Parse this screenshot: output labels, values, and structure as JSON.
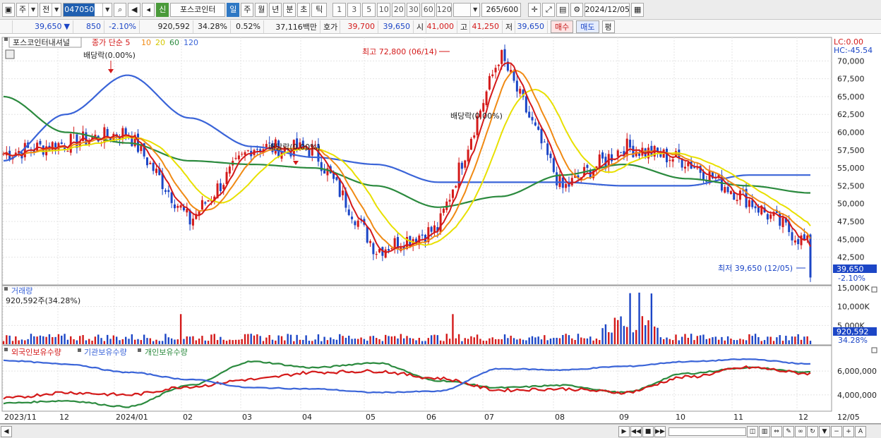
{
  "toolbar": {
    "period_main": "주",
    "prefix": "전",
    "stock_code": "047050",
    "stock_name": "포스코인터",
    "badge": "신",
    "periods": [
      "일",
      "주",
      "월",
      "년",
      "분",
      "초",
      "틱"
    ],
    "active_period": "일",
    "intervals": [
      "1",
      "3",
      "5",
      "10",
      "20",
      "30",
      "60",
      "120"
    ],
    "count": "265",
    "count_max": "/600",
    "date": "2024/12/05"
  },
  "quote": {
    "price": "39,650",
    "change_arrow": "▼",
    "change": "850",
    "change_pct": "-2.10%",
    "volume": "920,592",
    "volume_ratio": "34.28%",
    "turnover": "0.52%",
    "amount": "37,116백만",
    "ask_label": "호가",
    "ask": "39,700",
    "bid": "39,650",
    "open_label": "시",
    "open": "41,000",
    "high_label": "고",
    "high": "41,250",
    "low_label": "저",
    "low": "39,650",
    "buy_label": "매수",
    "sell_label": "매도",
    "eval_label": "평"
  },
  "price_pane": {
    "name_tag": "포스코인터내셔널",
    "legend": [
      {
        "label": "종가 단순 5",
        "color": "#d41a1a"
      },
      {
        "label": "10",
        "color": "#f08a14"
      },
      {
        "label": "20",
        "color": "#e8e000"
      },
      {
        "label": "60",
        "color": "#2b8a3e"
      },
      {
        "label": "120",
        "color": "#3a64d8"
      }
    ],
    "lc": "LC:0.00",
    "hc": "HC:-45.54",
    "yaxis": [
      "70,000",
      "67,500",
      "65,000",
      "62,500",
      "60,000",
      "57,500",
      "55,000",
      "52,500",
      "50,000",
      "47,500",
      "45,000",
      "42,500"
    ],
    "annotations": {
      "dividend1": "배당락(0.00%)",
      "dividend2": "배당락(0.00%)",
      "dividend3": "배당락(0.00%)",
      "high": "최고 72,800 (06/14)",
      "low": "최저 39,650 (12/05)"
    },
    "current_price": "39,650",
    "current_change": "-2.10%"
  },
  "volume_pane": {
    "title": "거래량",
    "summary": "920,592주(34.28%)",
    "yaxis": [
      "15,000K",
      "10,000K",
      "5,000K"
    ],
    "current": "920,592",
    "current_pct": "34.28%"
  },
  "holding_pane": {
    "legend": [
      {
        "label": "외국인보유수량",
        "color": "#d41a1a"
      },
      {
        "label": "기관보유수량",
        "color": "#3a64d8"
      },
      {
        "label": "개인보유수량",
        "color": "#2b8a3e"
      }
    ],
    "yaxis": [
      "6,000,000",
      "4,000,000"
    ]
  },
  "xaxis": [
    "2023/11",
    "12",
    "2024/01",
    "02",
    "03",
    "04",
    "05",
    "06",
    "07",
    "08",
    "09",
    "10",
    "11",
    "12",
    "12/05"
  ],
  "colors": {
    "up": "#d41a1a",
    "down": "#1c46c6",
    "ma5": "#d41a1a",
    "ma10": "#f08a14",
    "ma20": "#e8e000",
    "ma60": "#2b8a3e",
    "ma120": "#3a64d8"
  },
  "chart_data": {
    "type": "line",
    "title": "",
    "ylim": [
      39000,
      73000
    ],
    "x": [
      "2023/11",
      "12",
      "2024/01",
      "02",
      "03",
      "04",
      "05",
      "06",
      "07",
      "08",
      "09",
      "10",
      "11",
      "12"
    ],
    "series": [
      {
        "name": "종가 단순 5",
        "values": [
          57000,
          58500,
          60000,
          47500,
          58000,
          57500,
          43500,
          46500,
          71000,
          52000,
          58000,
          56000,
          50500,
          44000
        ]
      },
      {
        "name": "60",
        "values": [
          65000,
          60000,
          58500,
          56000,
          55500,
          55000,
          52500,
          49500,
          51000,
          54000,
          55500,
          53500,
          52500,
          51500
        ]
      },
      {
        "name": "120",
        "values": [
          56000,
          62500,
          68000,
          62000,
          58000,
          56500,
          55500,
          53000,
          53000,
          53000,
          52500,
          52500,
          54000,
          54000
        ]
      }
    ],
    "volume_max_k": 15000
  }
}
